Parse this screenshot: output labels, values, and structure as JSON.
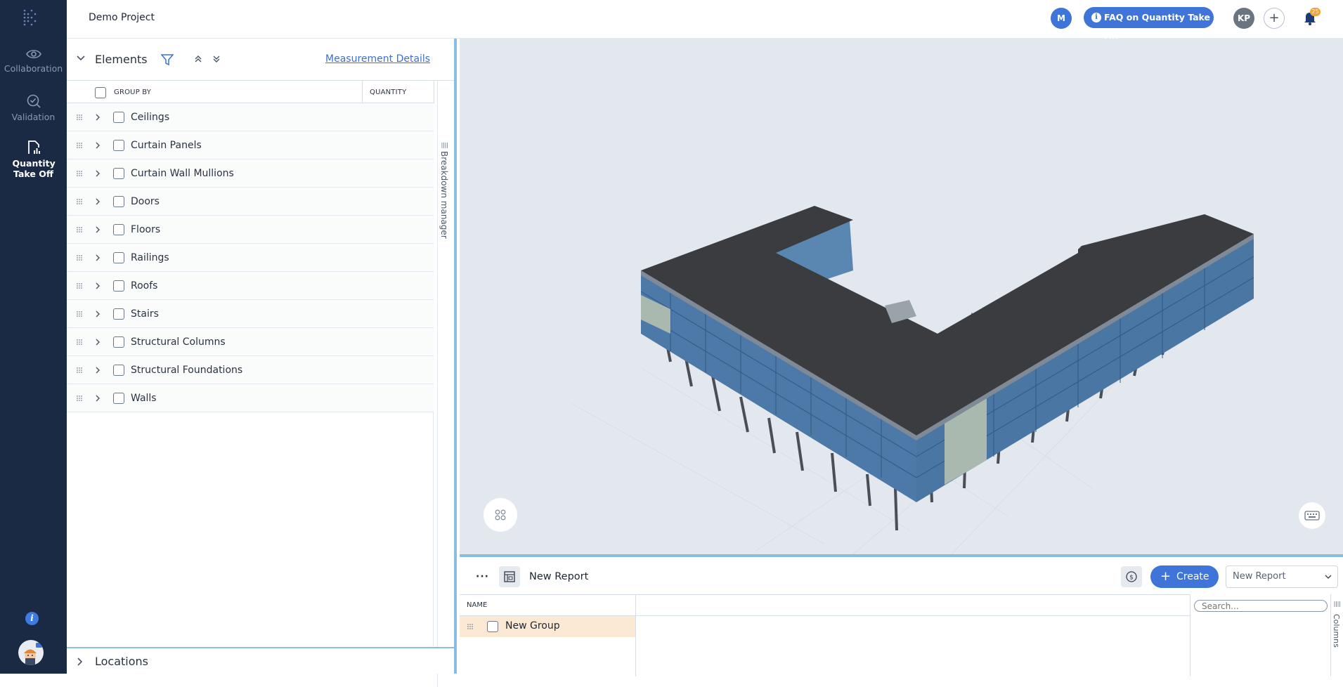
{
  "rail": {
    "items": [
      {
        "label": "Collaboration",
        "icon": "eye-icon"
      },
      {
        "label": "Validation",
        "icon": "check-circle-icon"
      },
      {
        "label": "Quantity Take Off",
        "icon": "document-chart-icon"
      }
    ],
    "info_icon": "i"
  },
  "topbar": {
    "project_name": "Demo Project",
    "user_avatar": "M",
    "faq_label": "FAQ on Quantity Take Off",
    "second_avatar": "KP",
    "add_symbol": "+",
    "notifications_badge": "25"
  },
  "elements_panel": {
    "title": "Elements",
    "measurement_link": "Measurement Details",
    "columns": {
      "group_by": "GROUP BY",
      "quantity": "QUANTITY"
    },
    "rows": [
      {
        "label": "Ceilings"
      },
      {
        "label": "Curtain Panels"
      },
      {
        "label": "Curtain Wall Mullions"
      },
      {
        "label": "Doors"
      },
      {
        "label": "Floors"
      },
      {
        "label": "Railings"
      },
      {
        "label": "Roofs"
      },
      {
        "label": "Stairs"
      },
      {
        "label": "Structural Columns"
      },
      {
        "label": "Structural Foundations"
      },
      {
        "label": "Walls"
      }
    ],
    "breakdown_label": "Breakdown manager",
    "locations_title": "Locations"
  },
  "report": {
    "more_label": "···",
    "title": "New Report",
    "create_label": "Create",
    "select_value": "New Report",
    "name_column": "NAME",
    "group_row": "New Group",
    "search_placeholder": "Search...",
    "columns_label": "Columns"
  },
  "colors": {
    "rail_bg": "#1b2a44",
    "accent": "#3f74d9",
    "panel_border": "#8bbde3",
    "badge": "#f2a23b",
    "selected_row": "#fbe9d4"
  }
}
